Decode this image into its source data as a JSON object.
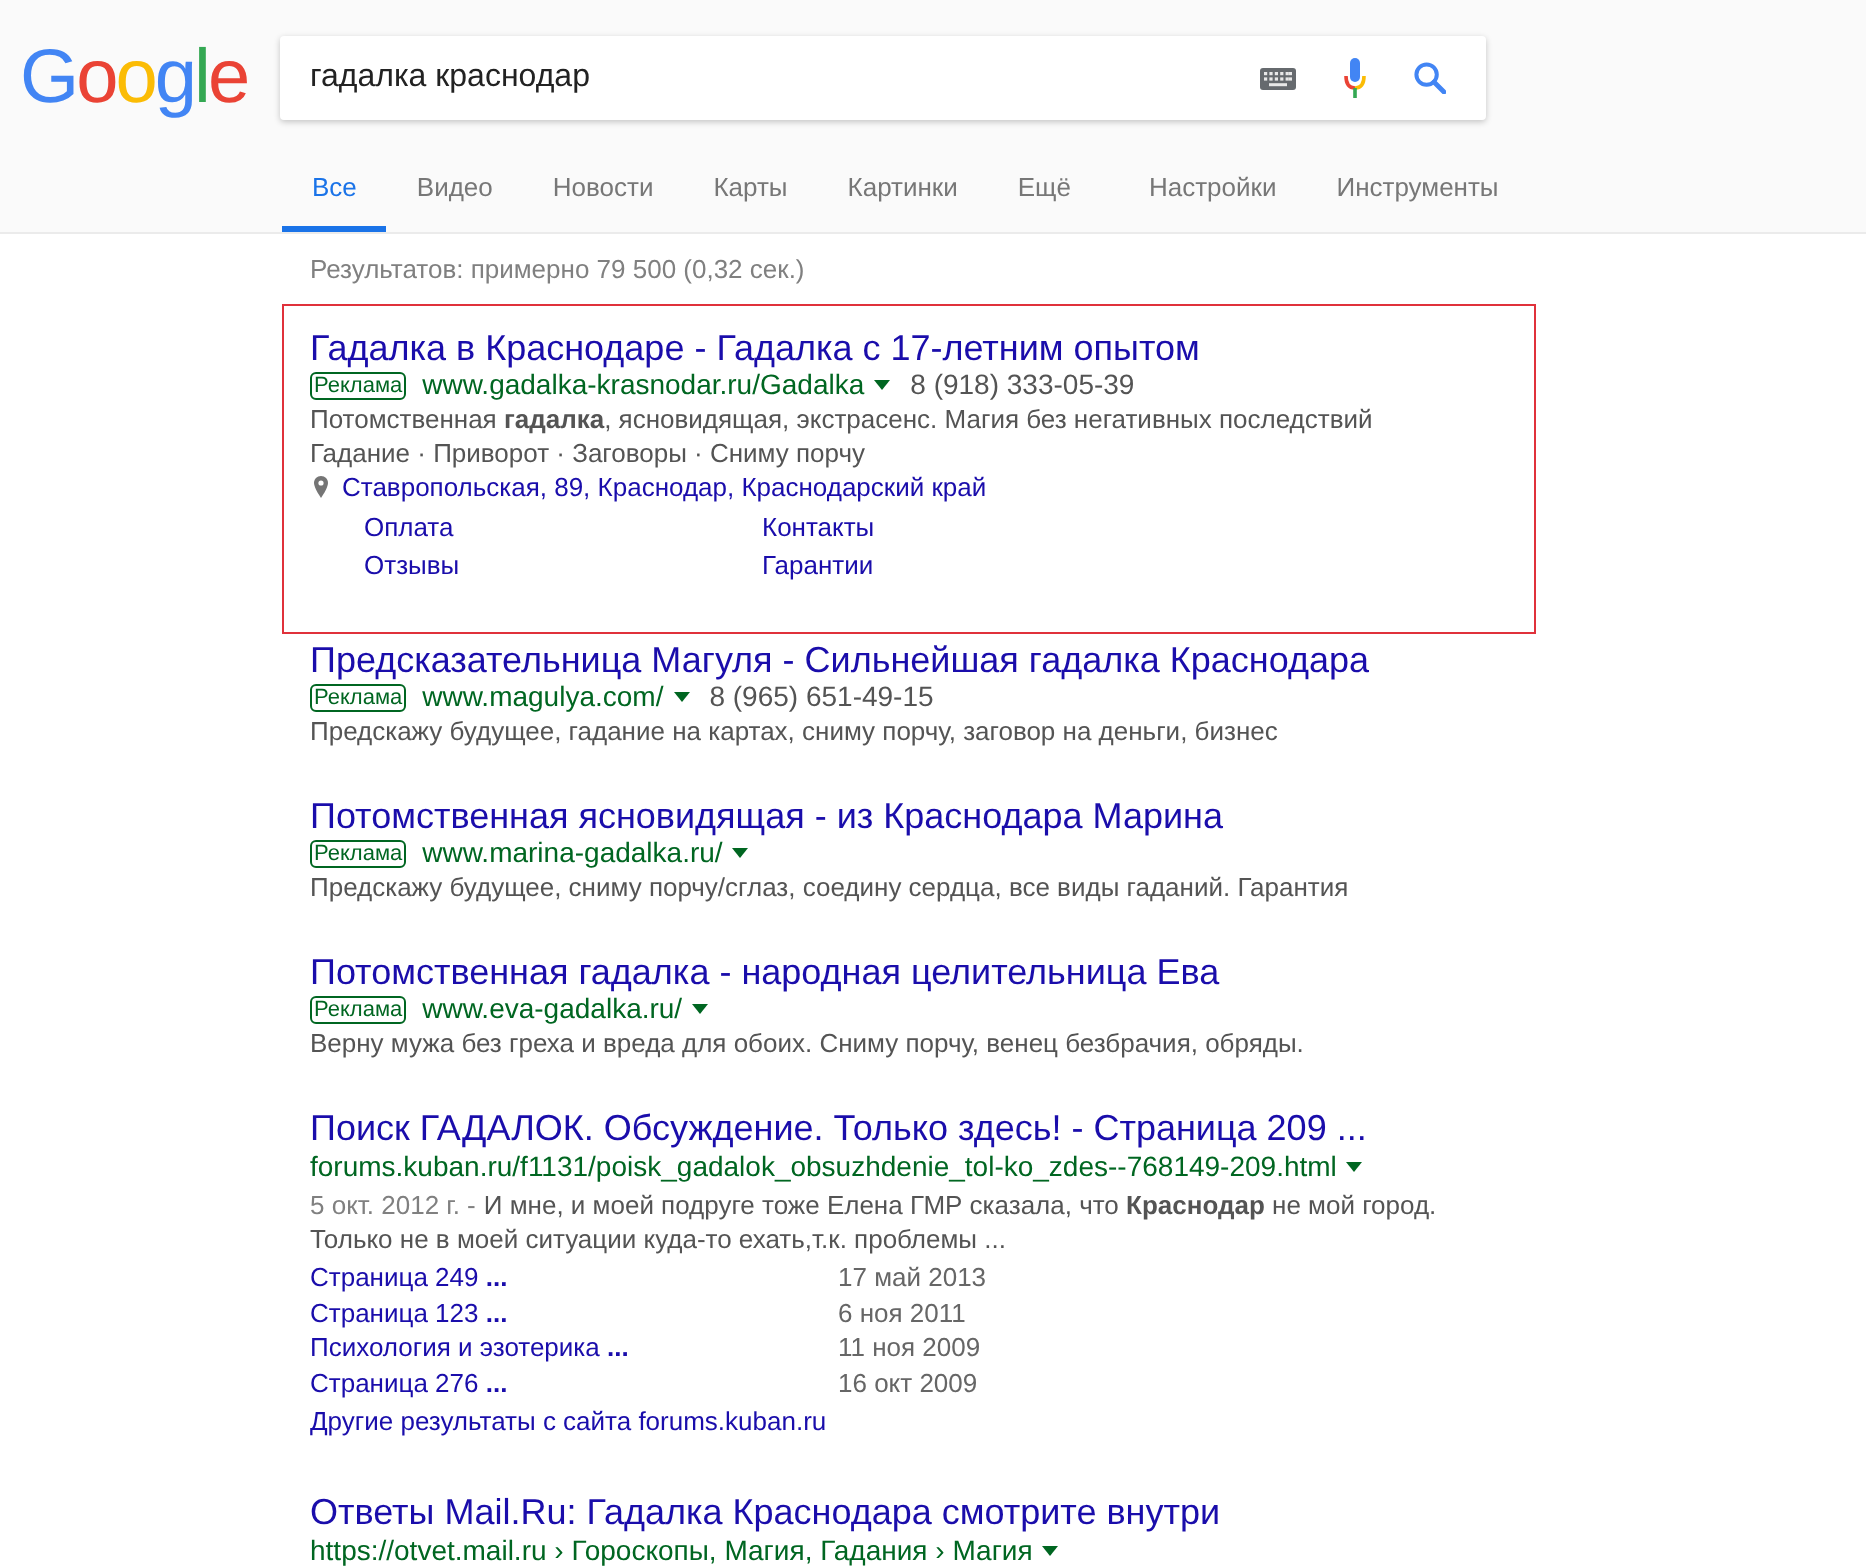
{
  "logo": {
    "text": "Google"
  },
  "search": {
    "query": "гадалка краснодар"
  },
  "tabs": [
    {
      "label": "Все",
      "selected": true
    },
    {
      "label": "Видео",
      "selected": false
    },
    {
      "label": "Новости",
      "selected": false
    },
    {
      "label": "Карты",
      "selected": false
    },
    {
      "label": "Картинки",
      "selected": false
    },
    {
      "label": "Ещё",
      "selected": false
    }
  ],
  "tools": [
    "Настройки",
    "Инструменты"
  ],
  "result_stats": "Результатов: примерно 79 500 (0,32 сек.)",
  "results": [
    {
      "kind": "ad",
      "highlighted": true,
      "title": "Гадалка в Краснодаре - Гадалка с 17-летним опытом",
      "badge": "Реклама",
      "url": "www.gadalka-krasnodar.ru/Gadalka",
      "phone": "8 (918) 333-05-39",
      "snippet": [
        "Потомственная **гадалка**, ясновидящая, экстрасенс. Магия без негативных последствий",
        "Гадание · Приворот · Заговоры · Сниму порчу"
      ],
      "address": "Ставропольская, 89, Краснодар, Краснодарский край",
      "sitelinks": [
        "Оплата",
        "Контакты",
        "Отзывы",
        "Гарантии"
      ]
    },
    {
      "kind": "ad",
      "highlighted": false,
      "title": "Предсказательница Магуля - Сильнейшая гадалка Краснодара",
      "badge": "Реклама",
      "url": "www.magulya.com/",
      "phone": "8 (965) 651-49-15",
      "snippet": [
        "Предскажу будущее, гадание на картах, сниму порчу, заговор на деньги, бизнес"
      ]
    },
    {
      "kind": "ad",
      "highlighted": false,
      "title": "Потомственная ясновидящая - из Краснодара Марина",
      "badge": "Реклама",
      "url": "www.marina-gadalka.ru/",
      "snippet": [
        "Предскажу будущее, сниму порчу/сглаз, соедину сердца, все виды гаданий. Гарантия"
      ]
    },
    {
      "kind": "ad",
      "highlighted": false,
      "title": "Потомственная гадалка - народная целительница Ева",
      "badge": "Реклама",
      "url": "www.eva-gadalka.ru/",
      "snippet": [
        "Верну мужа без греха и вреда для обоих. Сниму порчу, венец безбрачия, обряды."
      ]
    },
    {
      "kind": "organic",
      "title": "Поиск ГАДАЛОК. Обсуждение. Только здесь! - Страница 209 ...",
      "url": "forums.kuban.ru/f1131/poisk_gadalok_obsuzhdenie_tol-ko_zdes--768149-209.html",
      "date": "5 окт. 2012 г. -",
      "snippet": [
        "И мне, и моей подруге тоже Елена ГМР сказала, что **Краснодар** не мой город.",
        "Только не в моей ситуации куда-то ехать,т.к. проблемы ..."
      ],
      "sublinks": [
        {
          "title": "Страница 249 **...**",
          "date": "17 май 2013"
        },
        {
          "title": "Страница 123 **...**",
          "date": "6 ноя 2011"
        },
        {
          "title": "Психология и эзотерика **...**",
          "date": "11 ноя 2009"
        },
        {
          "title": "Страница 276 **...**",
          "date": "16 окт 2009"
        }
      ],
      "more": "Другие результаты с сайта forums.kuban.ru"
    },
    {
      "kind": "organic",
      "title": "Ответы Mail.Ru: Гадалка Краснодара смотрите внутри",
      "url": "https://otvet.mail.ru › Гороскопы, Магия, Гадания › Магия"
    }
  ]
}
